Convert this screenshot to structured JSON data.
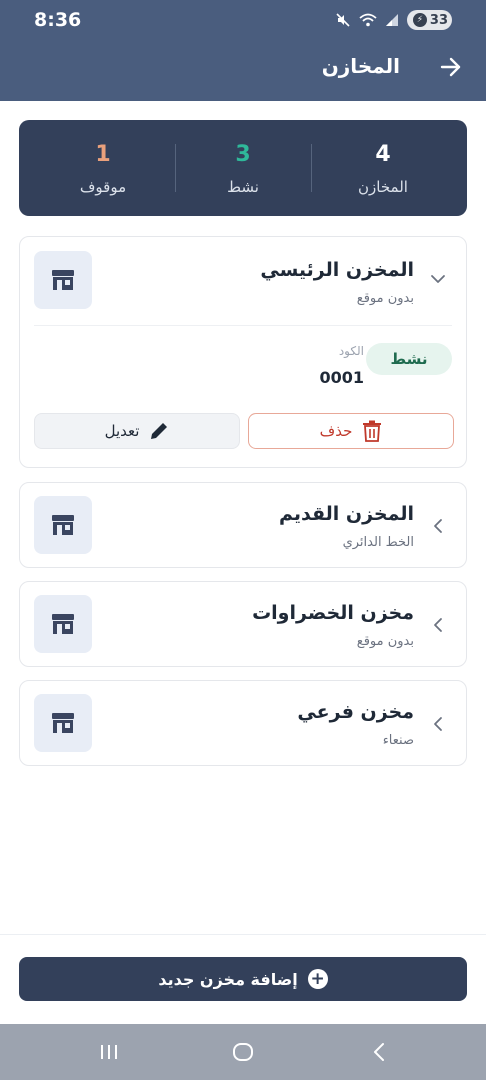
{
  "status": {
    "time": "8:36",
    "battery": "33"
  },
  "header": {
    "title": "المخازن"
  },
  "stats": [
    {
      "value": "4",
      "label": "المخازن",
      "color": "#ffffff"
    },
    {
      "value": "3",
      "label": "نشط",
      "color": "#2fb89a"
    },
    {
      "value": "1",
      "label": "موقوف",
      "color": "#e9a07c"
    }
  ],
  "warehouses": [
    {
      "name": "المخزن الرئيسي",
      "location": "بدون موقع",
      "expanded": true,
      "status": "نشط",
      "code_label": "الكود",
      "code": "0001",
      "delete_label": "حذف",
      "edit_label": "تعديل"
    },
    {
      "name": "المخزن القديم",
      "location": "الخط الدائري"
    },
    {
      "name": "مخزن الخضراوات",
      "location": "بدون موقع"
    },
    {
      "name": "مخزن فرعي",
      "location": "صنعاء"
    }
  ],
  "add_button": {
    "label": "إضافة مخزن جديد"
  },
  "icons": {
    "store": "store-icon",
    "chevron": "chevron-icon",
    "back": "arrow-right-icon",
    "trash": "trash-icon",
    "edit": "pencil-icon",
    "plus": "plus-icon"
  },
  "colors": {
    "header": "#4a5d7e",
    "panel": "#33405a",
    "active": "#2fb89a",
    "stopped": "#e9a07c",
    "danger": "#c0392b"
  }
}
